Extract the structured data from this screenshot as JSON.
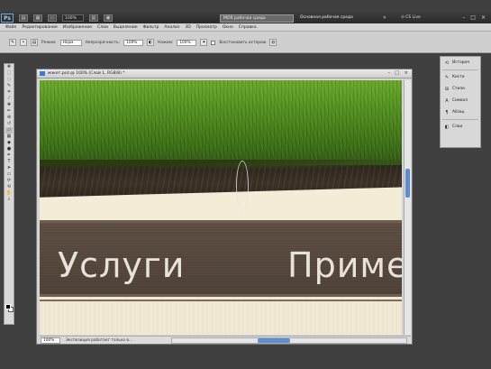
{
  "app": {
    "logo": "Ps",
    "zoom": "100%",
    "workspace_active": "МОЯ рабочая среда",
    "workspace_name": "Основная рабочая среда",
    "cs_live": "CS Live",
    "minimize": "–",
    "maximize": "□",
    "close": "×"
  },
  "menu": [
    "Файл",
    "Редактирование",
    "Изображение",
    "Слои",
    "Выделение",
    "Фильтр",
    "Анализ",
    "3D",
    "Просмотр",
    "Окно",
    "Справка"
  ],
  "options": {
    "mode_label": "Режим:",
    "mode_value": "Норм.",
    "opacity_label": "Непрозрачность:",
    "opacity_value": "100%",
    "pressure_label": "Нажим:",
    "pressure_value": "100%",
    "erase_history_label": "Восстановить историю"
  },
  "document": {
    "title": "макет.psd @ 100% (Слой 1, RGB/8) *",
    "nav_items": [
      "Услуги",
      "Приме"
    ],
    "zoom_value": "100%",
    "status_text": "Экспозиция работает только в..."
  },
  "panels": {
    "items": [
      {
        "label": "История",
        "icon": "history-icon"
      },
      {
        "label": "Кисти",
        "icon": "brush-icon"
      },
      {
        "label": "Стили",
        "icon": "styles-icon"
      },
      {
        "label": "Символ",
        "icon": "character-icon"
      },
      {
        "label": "Абзац",
        "icon": "paragraph-icon"
      },
      {
        "label": "Слои",
        "icon": "layers-icon"
      }
    ]
  },
  "tools": [
    "move-tool",
    "marquee-tool",
    "lasso-tool",
    "quick-select-tool",
    "crop-tool",
    "eyedropper-tool",
    "healing-tool",
    "brush-tool",
    "clone-tool",
    "history-brush-tool",
    "eraser-tool",
    "gradient-tool",
    "blur-tool",
    "dodge-tool",
    "pen-tool",
    "type-tool",
    "path-select-tool",
    "shape-tool",
    "3d-rotate-tool",
    "3d-camera-tool",
    "hand-tool",
    "zoom-tool"
  ]
}
